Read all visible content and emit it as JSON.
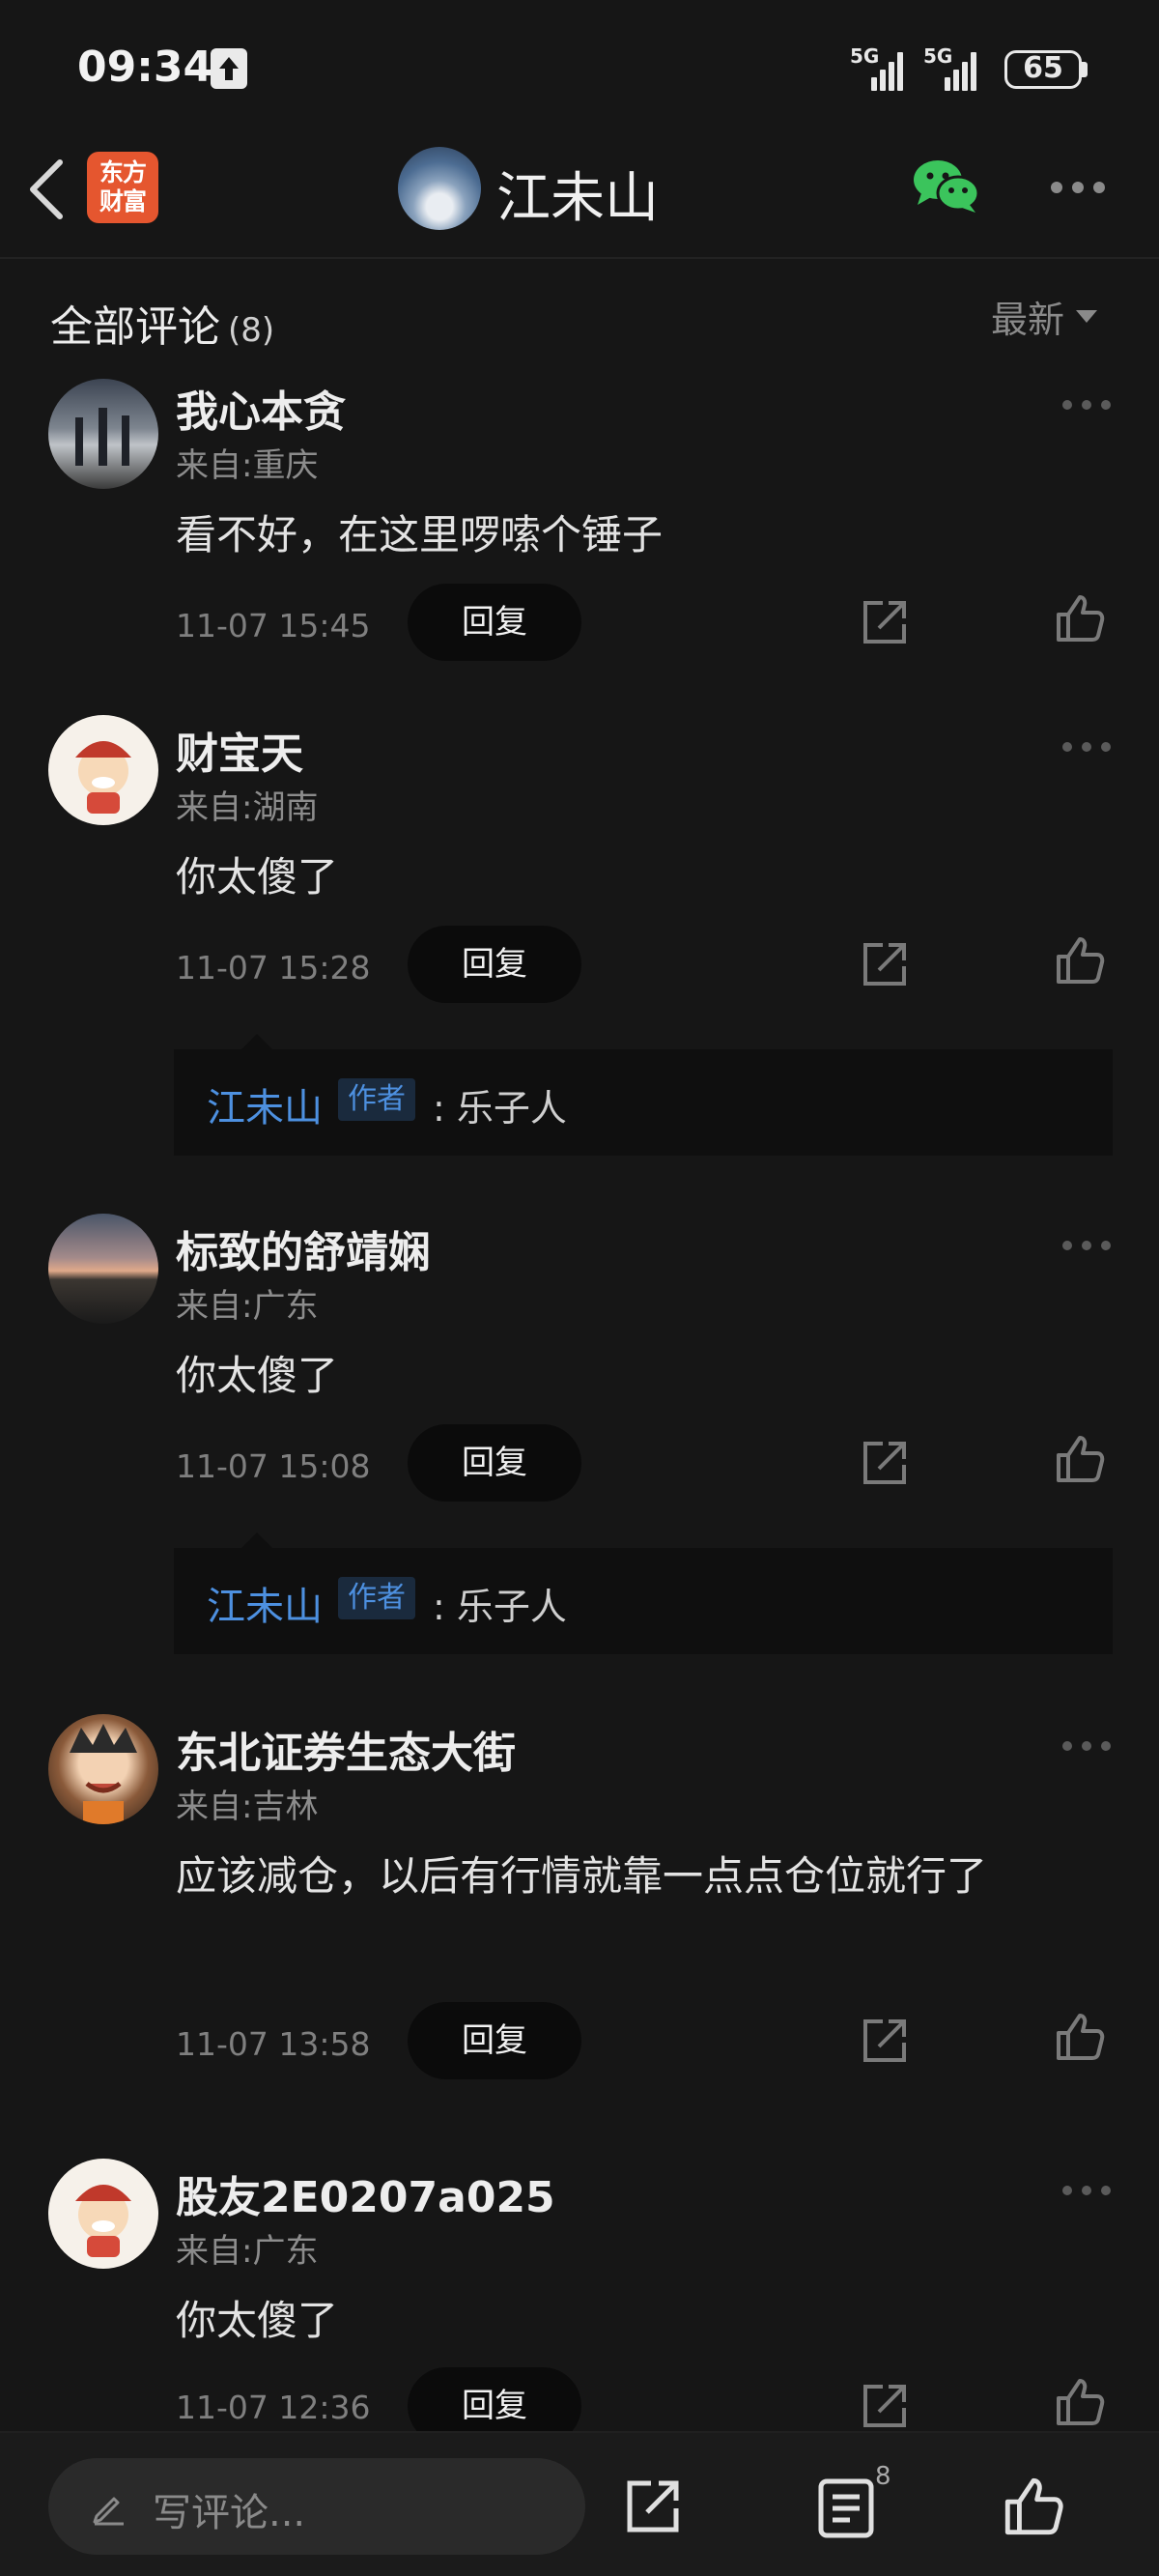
{
  "status_bar": {
    "time": "09:34",
    "network_1": "5G",
    "network_2": "5G",
    "battery": "65"
  },
  "header": {
    "app_logo_line1": "东方",
    "app_logo_line2": "财富",
    "author_name": "江未山"
  },
  "section": {
    "title": "全部评论",
    "count": "(8)",
    "sort_label": "最新"
  },
  "comments": [
    {
      "name": "我心本贪",
      "location": "来自:重庆",
      "text": "看不好，在这里啰嗦个锤子",
      "time": "11-07 15:45",
      "reply_label": "回复"
    },
    {
      "name": "财宝天",
      "location": "来自:湖南",
      "text": "你太傻了",
      "time": "11-07 15:28",
      "reply_label": "回复",
      "sub_reply": {
        "author": "江未山",
        "badge": "作者",
        "text": ": 乐子人"
      }
    },
    {
      "name": "标致的舒靖娴",
      "location": "来自:广东",
      "text": "你太傻了",
      "time": "11-07 15:08",
      "reply_label": "回复",
      "sub_reply": {
        "author": "江未山",
        "badge": "作者",
        "text": ": 乐子人"
      }
    },
    {
      "name": "东北证券生态大街",
      "location": "来自:吉林",
      "text": "应该减仓，以后有行情就靠一点点仓位就行了",
      "time": "11-07 13:58",
      "reply_label": "回复"
    },
    {
      "name": "股友2E0207a025",
      "location": "来自:广东",
      "text": "你太傻了",
      "time": "11-07 12:36",
      "reply_label": "回复"
    }
  ],
  "bottom_bar": {
    "comment_placeholder": "写评论...",
    "comment_count": "8"
  },
  "colors": {
    "background": "#161616",
    "accent_blue": "#4d90e0",
    "logo_orange": "#e5562f",
    "wechat_green": "#3bc45c"
  }
}
